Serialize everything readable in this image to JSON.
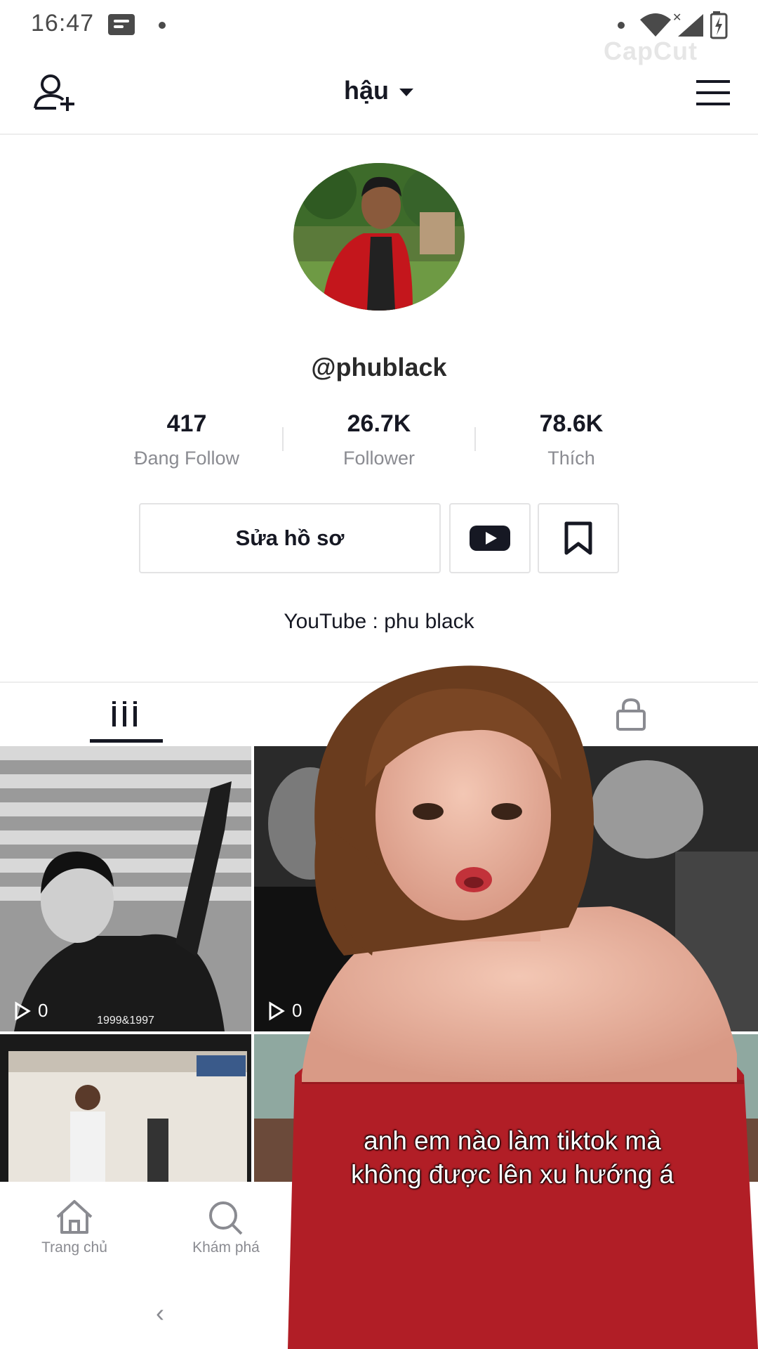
{
  "status_bar": {
    "time": "16:47"
  },
  "watermark": "CapCut",
  "header": {
    "username": "hậu"
  },
  "profile": {
    "handle": "@phublack",
    "stats": [
      {
        "value": "417",
        "label": "Đang Follow"
      },
      {
        "value": "26.7K",
        "label": "Follower"
      },
      {
        "value": "78.6K",
        "label": "Thích"
      }
    ],
    "edit_button": "Sửa hồ sơ",
    "bio": "YouTube : phu black"
  },
  "grid": {
    "items": [
      {
        "views": "0",
        "overlay_text": "1999&1997"
      },
      {
        "views": "0"
      },
      {},
      {}
    ]
  },
  "bottom_nav": {
    "items": [
      {
        "label": "Trang chủ",
        "icon": "home-icon"
      },
      {
        "label": "Khám phá",
        "icon": "search-icon"
      }
    ]
  },
  "overlay": {
    "caption_line1": "anh em nào làm tiktok mà",
    "caption_line2": "không được lên xu hướng á"
  },
  "colors": {
    "text": "#161823",
    "secondary": "#8a8b91",
    "border": "#e3e3e4",
    "youtube": "#161823"
  }
}
